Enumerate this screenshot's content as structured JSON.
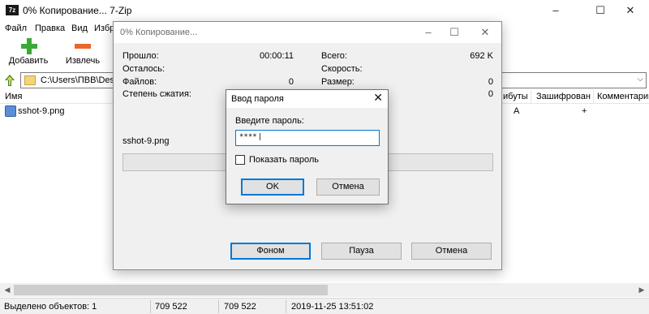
{
  "main": {
    "title": "0% Копирование... 7-Zip",
    "icon_text": "7z",
    "window_controls": {
      "minimize": "–",
      "maximize": "☐",
      "close": "✕"
    },
    "menu": [
      "Файл",
      "Правка",
      "Вид",
      "Избр"
    ],
    "toolbar": {
      "add_label": "Добавить",
      "extract_label": "Извлечь"
    },
    "address": "C:\\Users\\ПВВ\\Deskt",
    "columns": {
      "name": "Имя",
      "attributes": "ибуты",
      "encrypted": "Зашифрован",
      "comment": "Комментарий"
    },
    "files": [
      {
        "name": "sshot-9.png",
        "attributes": "A",
        "encrypted": "+"
      }
    ],
    "status": {
      "selected": "Выделено объектов: 1",
      "size": "709 522",
      "packed": "709 522",
      "modified": "2019-11-25 13:51:02"
    }
  },
  "progress": {
    "title": "0% Копирование...",
    "window_controls": {
      "minimize": "–",
      "maximize": "☐",
      "close": "✕"
    },
    "elapsed_label": "Прошло:",
    "elapsed": "00:00:11",
    "remaining_label": "Осталось:",
    "files_label": "Файлов:",
    "files": "0",
    "ratio_label": "Степень сжатия:",
    "total_label": "Всего:",
    "total": "692 K",
    "speed_label": "Скорость:",
    "size_label": "Размер:",
    "size": "0",
    "fourth_value": "0",
    "current_file": "sshot-9.png",
    "progress_fraction": 0,
    "buttons": {
      "background": "Фоном",
      "pause": "Пауза",
      "cancel": "Отмена"
    }
  },
  "password_dialog": {
    "title": "Ввод пароля",
    "close": "✕",
    "prompt": "Введите пароль:",
    "value": "****",
    "show_password_label": "Показать пароль",
    "show_password_checked": false,
    "ok": "OK",
    "cancel": "Отмена"
  },
  "colors": {
    "accent": "#0078d7",
    "add_icon": "#3aaa35",
    "extract_icon": "#e8692a"
  }
}
